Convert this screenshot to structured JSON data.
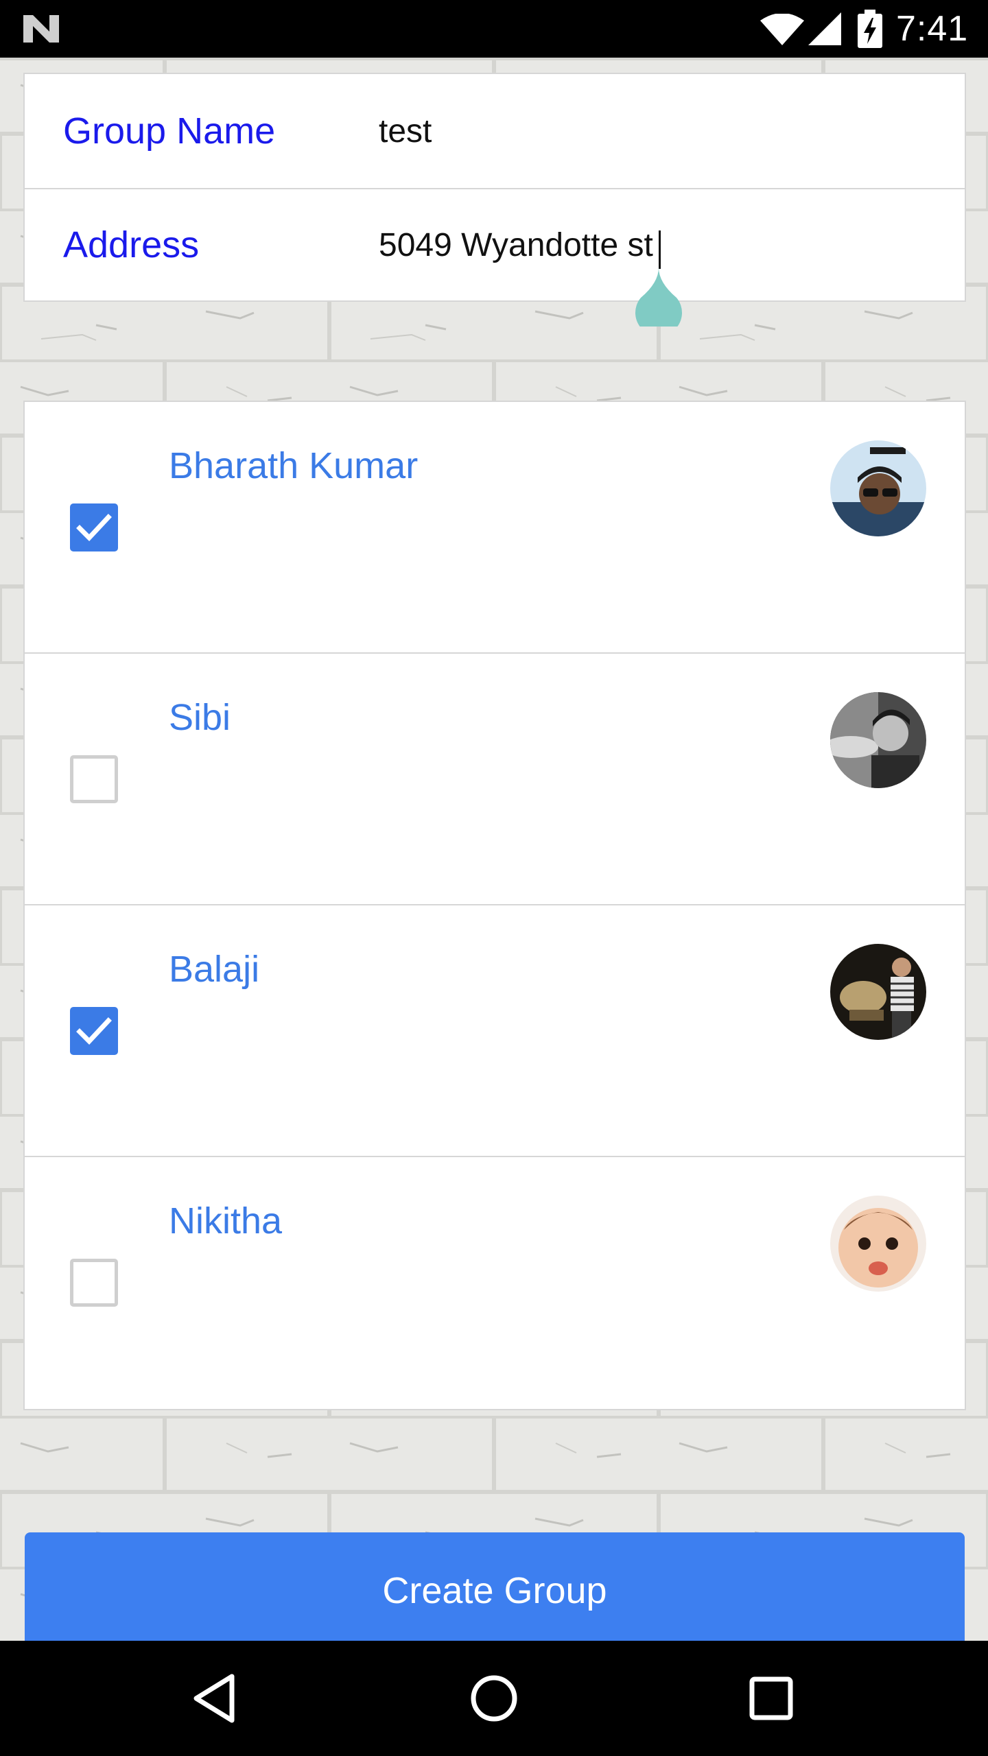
{
  "status_bar": {
    "time": "7:41"
  },
  "form": {
    "group_name_label": "Group Name",
    "group_name_value": "test",
    "address_label": "Address",
    "address_value": "5049 Wyandotte st"
  },
  "members": [
    {
      "name": "Bharath Kumar",
      "checked": true
    },
    {
      "name": "Sibi",
      "checked": false
    },
    {
      "name": "Balaji",
      "checked": true
    },
    {
      "name": "Nikitha",
      "checked": false
    }
  ],
  "create_button_label": "Create Group",
  "colors": {
    "label_blue": "#1a1aeb",
    "name_blue": "#3b7be6",
    "button_blue": "#3d7ff0",
    "caret_handle_teal": "#80cbc4"
  },
  "icons": [
    "n-logo-icon",
    "wifi-icon",
    "signal-icon",
    "battery-charging-icon",
    "check-icon",
    "back-icon",
    "home-icon",
    "recents-icon"
  ]
}
